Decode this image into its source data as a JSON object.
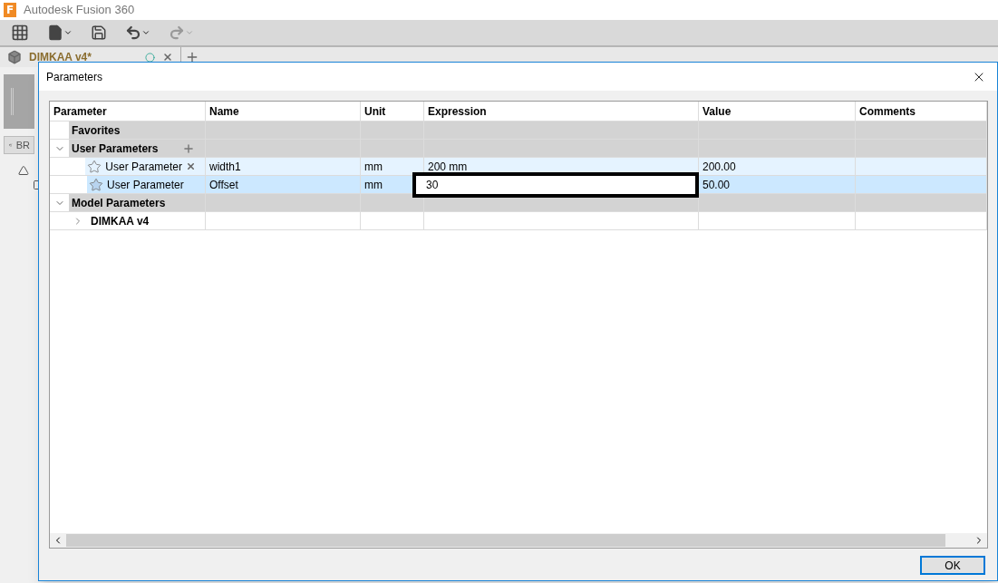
{
  "app": {
    "logo": "F",
    "title": "Autodesk Fusion 360"
  },
  "document_tab": {
    "title": "DIMKAA v4*"
  },
  "browser": {
    "label": "BR"
  },
  "dialog": {
    "title": "Parameters",
    "table": {
      "columns": [
        "Parameter",
        "Name",
        "Unit",
        "Expression",
        "Value",
        "Comments"
      ],
      "groups": [
        {
          "label": "Favorites"
        },
        {
          "label": "User Parameters",
          "expanded": true,
          "can_add": true,
          "children": [
            {
              "kind": "param",
              "parameter": "User Parameter",
              "name": "width1",
              "unit": "mm",
              "expression": "200 mm",
              "value": "200.00",
              "hovered": true,
              "selected": false,
              "editing": false
            },
            {
              "kind": "param",
              "parameter": "User Parameter",
              "name": "Offset",
              "unit": "mm",
              "expression": "30",
              "value": "50.00",
              "hovered": false,
              "selected": true,
              "editing": true
            }
          ]
        },
        {
          "label": "Model Parameters",
          "expanded": true,
          "children": [
            {
              "kind": "component",
              "label": "DIMKAA v4",
              "expanded": false
            }
          ]
        }
      ]
    },
    "buttons": [
      "OK"
    ]
  }
}
